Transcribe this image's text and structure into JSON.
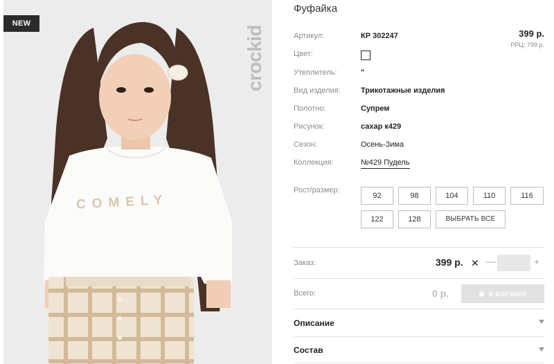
{
  "product": {
    "badge": "NEW",
    "brand": "crockid",
    "tshirt_print": "COMELY",
    "title": "Фуфайка"
  },
  "price": {
    "main": "399 р.",
    "rrc": "РРЦ: 799 р."
  },
  "specs": {
    "article_label": "Артикул:",
    "article_value": "КР 302247",
    "color_label": "Цвет:",
    "insulation_label": "Утеплитель:",
    "insulation_value": "\"",
    "type_label": "Вид изделия:",
    "type_value": "Трикотажные изделия",
    "fabric_label": "Полотно:",
    "fabric_value": "Супрем",
    "pattern_label": "Рисунок:",
    "pattern_value": "сахар к429",
    "season_label": "Сезон:",
    "season_value": "Осень-Зима",
    "collection_label": "Коллекция:",
    "collection_value": "№429 Пудель"
  },
  "sizes": {
    "label": "Рост/размер:",
    "options": [
      "92",
      "98",
      "104",
      "110",
      "116",
      "122",
      "128"
    ],
    "select_all": "ВЫБРАТЬ ВСЕ"
  },
  "order": {
    "label": "Заказ:",
    "price": "399 р.",
    "times": "✕",
    "minus": "—",
    "plus": "+",
    "quantity": ""
  },
  "total": {
    "label": "Всего:",
    "value": "0 р.",
    "cart_button": "В КОРЗИНУ"
  },
  "accordion": {
    "description": "Описание",
    "composition": "Состав"
  },
  "colors": {
    "badge_bg": "#2b2b2b",
    "cart_bg": "#e1e1e1",
    "divider": "#e3e3e3",
    "label_gray": "#8a8a8a"
  }
}
